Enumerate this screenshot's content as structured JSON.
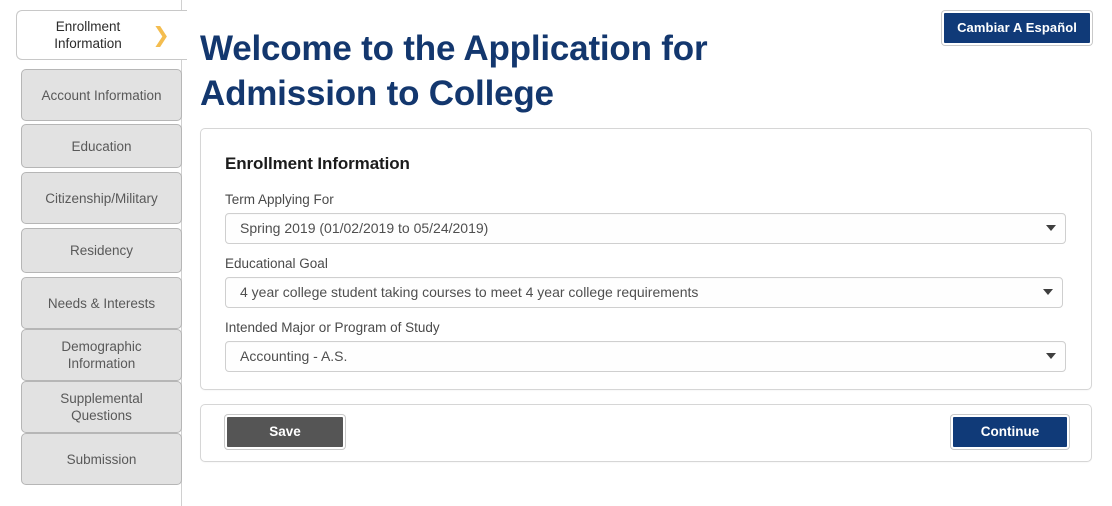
{
  "sidebar": {
    "items": [
      {
        "label": "Enrollment Information",
        "active": true,
        "icon": "chevron-right-icon",
        "chevron": "❯"
      },
      {
        "label": "Account Information",
        "active": false
      },
      {
        "label": "Education",
        "active": false
      },
      {
        "label": "Citizenship/Military",
        "active": false
      },
      {
        "label": "Residency",
        "active": false
      },
      {
        "label": "Needs & Interests",
        "active": false
      },
      {
        "label": "Demographic Information",
        "active": false
      },
      {
        "label": "Supplemental Questions",
        "active": false
      },
      {
        "label": "Submission",
        "active": false
      }
    ]
  },
  "header": {
    "title": "Welcome to the Application for Admission to College",
    "language_toggle_label": "Cambiar A Español"
  },
  "form": {
    "card_title": "Enrollment Information",
    "fields": [
      {
        "name": "term-applying-for",
        "label": "Term Applying For",
        "value": "Spring 2019 (01/02/2019 to 05/24/2019)"
      },
      {
        "name": "educational-goal",
        "label": "Educational Goal",
        "value": "4 year college student taking courses to meet 4 year college requirements"
      },
      {
        "name": "intended-major",
        "label": "Intended Major or Program of Study",
        "value": "Accounting - A.S."
      }
    ]
  },
  "actions": {
    "save_label": "Save",
    "continue_label": "Continue"
  },
  "colors": {
    "navy": "#103a78",
    "title_navy": "#13376e",
    "gold_chevron": "#f4bd4f",
    "save_gray": "#555555",
    "tab_gray": "#e2e2e2"
  }
}
